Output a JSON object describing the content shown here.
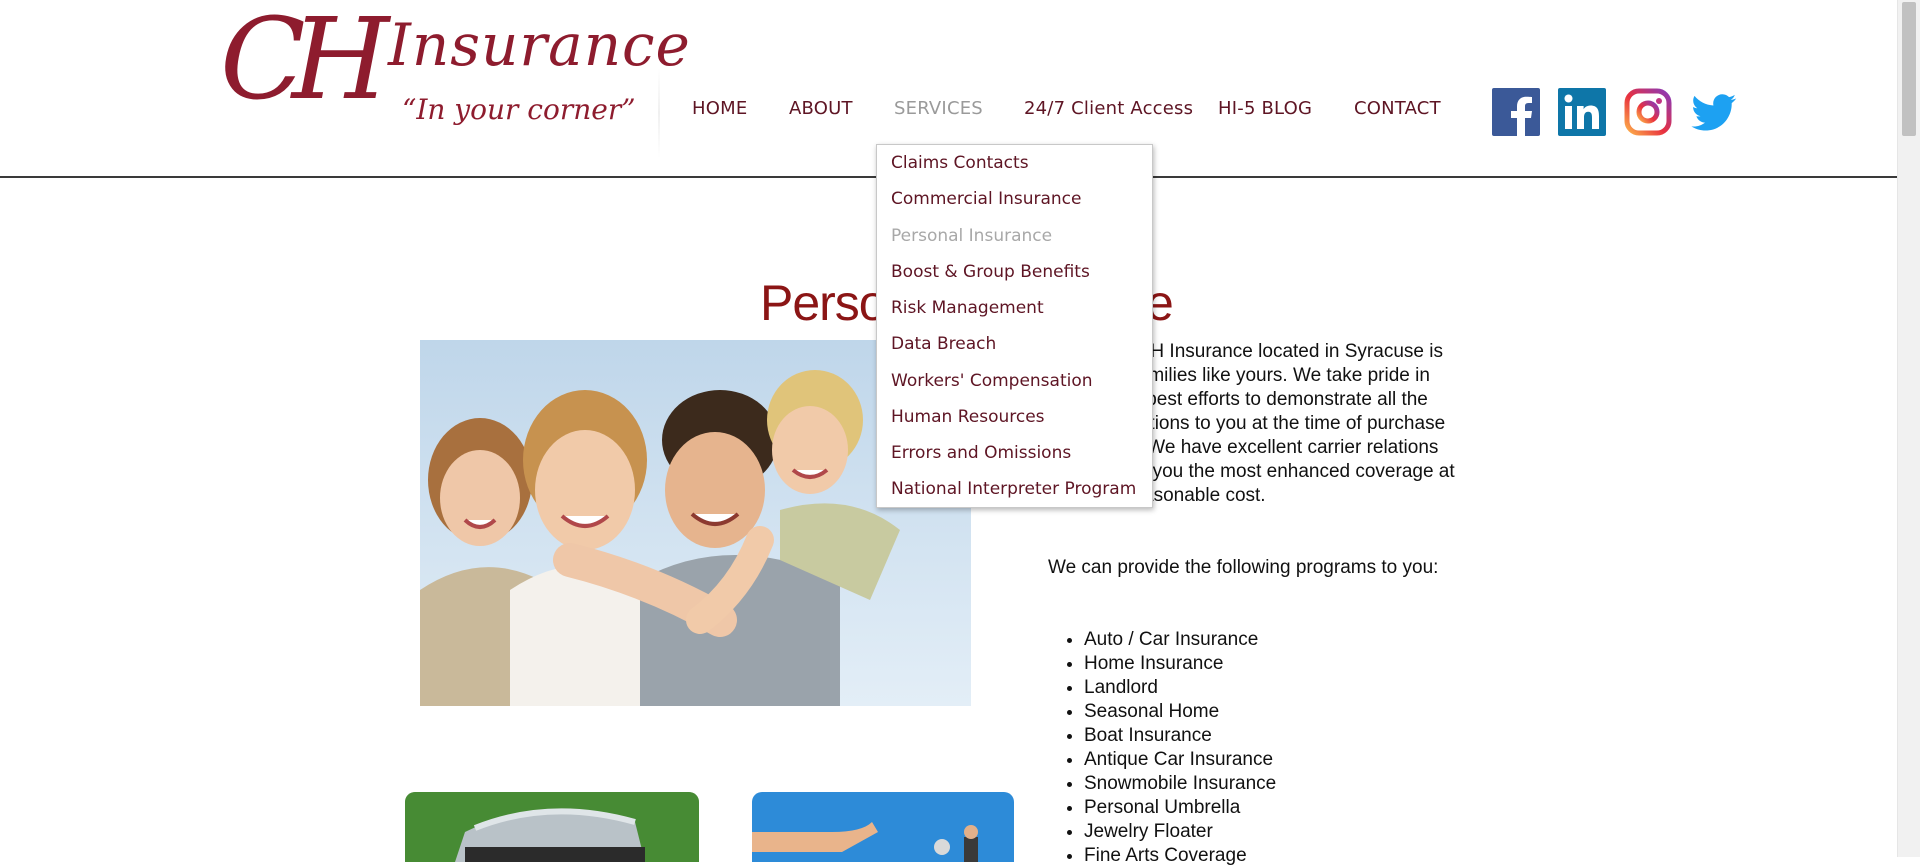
{
  "header": {
    "logo": {
      "monogram": "CH",
      "word": "Insurance",
      "tagline": "“In your corner”"
    },
    "nav": [
      {
        "label": "HOME",
        "active": false
      },
      {
        "label": "ABOUT",
        "active": false
      },
      {
        "label": "SERVICES",
        "active": true
      },
      {
        "label": "24/7 Client Access",
        "active": false
      },
      {
        "label": "HI-5 BLOG",
        "active": false
      },
      {
        "label": "CONTACT",
        "active": false
      }
    ],
    "social": [
      {
        "icon": "facebook-icon",
        "color": "#3b5998"
      },
      {
        "icon": "linkedin-icon",
        "color": "#0e76a8"
      },
      {
        "icon": "instagram-icon",
        "color": "#c13584"
      },
      {
        "icon": "twitter-icon",
        "color": "#1da1f2"
      }
    ]
  },
  "services_dropdown": [
    {
      "label": "Claims Contacts",
      "active": false
    },
    {
      "label": "Commercial Insurance",
      "active": false
    },
    {
      "label": "Personal Insurance",
      "active": true
    },
    {
      "label": "Boost & Group Benefits",
      "active": false
    },
    {
      "label": "Risk Management",
      "active": false
    },
    {
      "label": "Data Breach",
      "active": false
    },
    {
      "label": "Workers' Compensation",
      "active": false
    },
    {
      "label": "Human Resources",
      "active": false
    },
    {
      "label": "Errors and Omissions",
      "active": false
    },
    {
      "label": "National Interpreter Program",
      "active": false
    }
  ],
  "main": {
    "title": "Personal Insurance",
    "intro": "Our job at CH Insurance located in Syracuse is to protect families like yours. We take pride in making the best efforts to demonstrate all the available options to you at the time of purchase or renewal. We have excellent carrier relations that provide you the most enhanced coverage at the most reasonable cost.",
    "programs_intro": "We can provide the following programs to you:",
    "programs": [
      "Auto / Car Insurance",
      "Home Insurance",
      "Landlord",
      "Seasonal Home",
      "Boat Insurance",
      "Antique Car Insurance",
      "Snowmobile Insurance",
      "Personal Umbrella",
      "Jewelry Floater",
      "Fine Arts Coverage"
    ]
  },
  "colors": {
    "brand": "#8e1c2e",
    "nav_text": "#5e1524",
    "title": "#8b1515"
  }
}
